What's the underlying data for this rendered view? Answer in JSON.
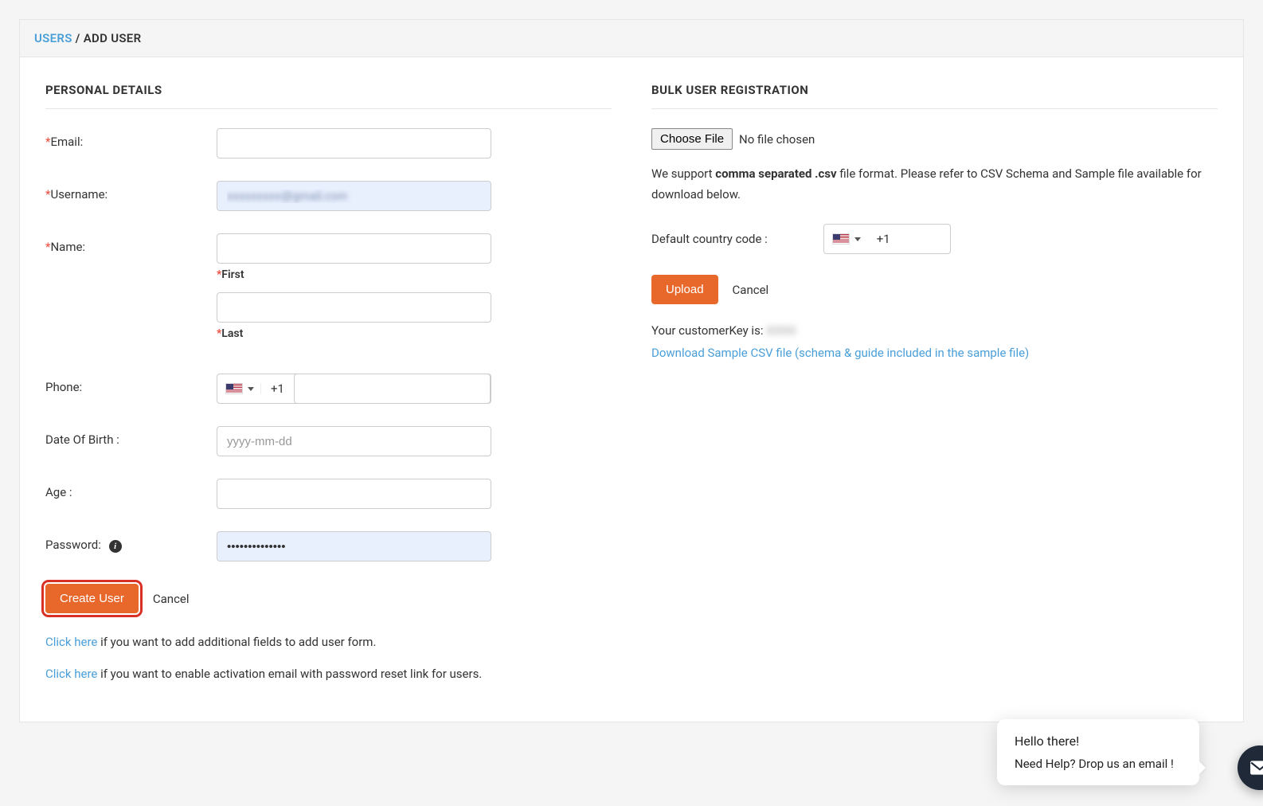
{
  "breadcrumb": {
    "link": "USERS",
    "sep": " / ",
    "current": "ADD USER"
  },
  "personal": {
    "title": "PERSONAL DETAILS",
    "email_label": "Email:",
    "username_label": "Username:",
    "username_value": "xxxxxxxxx@gmail.com",
    "name_label": "Name:",
    "first_label": "First",
    "last_label": "Last",
    "phone_label": "Phone:",
    "phone_code": "+1",
    "dob_label": "Date Of Birth :",
    "dob_placeholder": "yyyy-mm-dd",
    "age_label": "Age :",
    "password_label": "Password:",
    "password_value": "••••••••••••••",
    "create_btn": "Create User",
    "cancel_btn": "Cancel",
    "help1_link": "Click here",
    "help1_rest": " if you want to add additional fields to add user form.",
    "help2_link": "Click here",
    "help2_rest": " if you want to enable activation email with password reset link for users."
  },
  "bulk": {
    "title": "BULK USER REGISTRATION",
    "choose_file": "Choose File",
    "no_file": "No file chosen",
    "support_pre": "We support ",
    "support_bold": "comma separated .csv",
    "support_post": " file format. Please refer to CSV Schema and Sample file available for download below.",
    "cc_label": "Default country code :",
    "cc_code": "+1",
    "upload_btn": "Upload",
    "cancel_btn": "Cancel",
    "ck_label": "Your customerKey is: ",
    "ck_value": "XXXX",
    "download_link": "Download Sample CSV file (schema & guide included in the sample file)"
  },
  "chat": {
    "line1": "Hello there!",
    "line2": "Need Help? Drop us an email !"
  }
}
